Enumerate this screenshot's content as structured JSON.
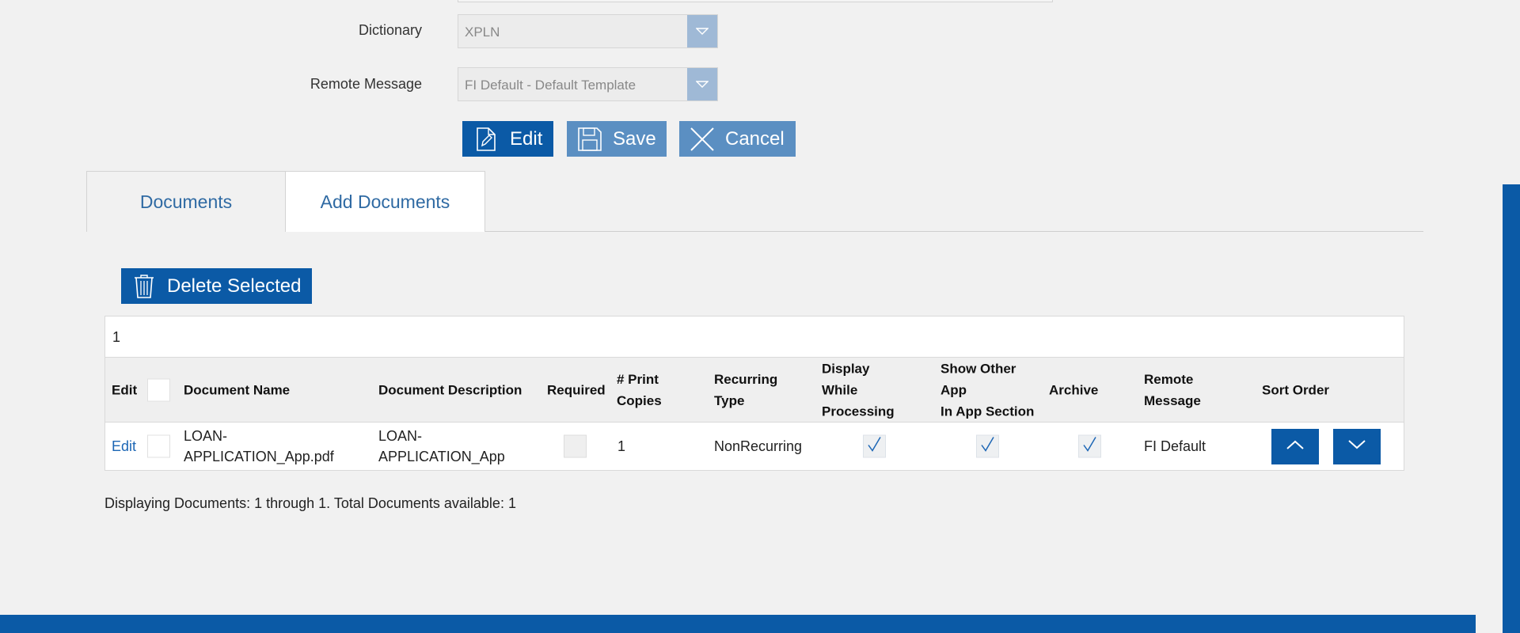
{
  "form": {
    "dictionary_label": "Dictionary",
    "dictionary_value": "XPLN",
    "remote_message_label": "Remote Message",
    "remote_message_value": "FI Default - Default Template"
  },
  "actions": {
    "edit_label": "Edit",
    "save_label": "Save",
    "cancel_label": "Cancel"
  },
  "tabs": [
    {
      "label": "Documents"
    },
    {
      "label": "Add Documents"
    }
  ],
  "grid": {
    "delete_label": "Delete Selected",
    "pager_page": "1",
    "headers": {
      "edit": "Edit",
      "document_name": "Document Name",
      "document_description": "Document Description",
      "required": "Required",
      "print_copies_1": "# Print",
      "print_copies_2": "Copies",
      "recurring_type_1": "Recurring",
      "recurring_type_2": "Type",
      "display_1": "Display",
      "display_2": "While",
      "display_3": "Processing",
      "show_other_1": "Show Other",
      "show_other_2": "App",
      "show_other_3": "In App Section",
      "archive": "Archive",
      "remote_message_1": "Remote",
      "remote_message_2": "Message",
      "sort_order": "Sort Order"
    },
    "rows": [
      {
        "edit_link": "Edit",
        "document_name_1": "LOAN-",
        "document_name_2": "APPLICATION_App.pdf",
        "document_description_1": "LOAN-",
        "document_description_2": "APPLICATION_App",
        "required": false,
        "print_copies": "1",
        "recurring_type": "NonRecurring",
        "display_while_processing": true,
        "show_other_app": true,
        "archive": true,
        "remote_message": "FI Default"
      }
    ],
    "summary": "Displaying Documents: 1 through 1. Total Documents available: 1"
  },
  "icons": {
    "edit": "pencil-doc-icon",
    "save": "floppy-disk-icon",
    "cancel": "x-icon",
    "delete": "trash-icon",
    "dropdown": "triangle-down-icon",
    "sort_up": "chevron-up-icon",
    "sort_down": "chevron-down-icon",
    "check": "checkmark-icon"
  },
  "colors": {
    "primary": "#0b5aa6",
    "secondary_button": "#5b8fc2",
    "select_arrow": "#9fb9d6",
    "link": "#1c66b5",
    "background": "#f1f1f1"
  }
}
